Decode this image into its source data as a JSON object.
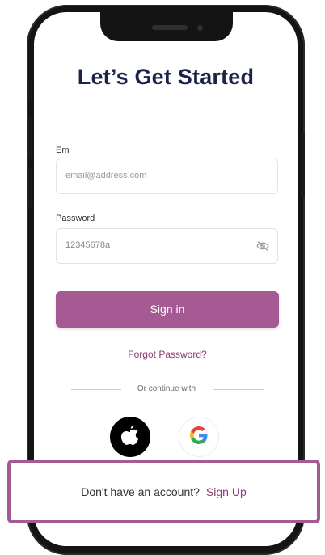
{
  "screen": {
    "title": "Let’s Get Started"
  },
  "email": {
    "label": "Em",
    "placeholder": "email@address.com"
  },
  "password": {
    "label": "Password",
    "value": "12345678a",
    "toggle_icon": "eye-off-icon"
  },
  "actions": {
    "sign_in": "Sign in",
    "forgot_password": "Forgot Password?",
    "divider": "Or continue with",
    "social": [
      {
        "provider": "apple",
        "icon": "apple-icon"
      },
      {
        "provider": "google",
        "icon": "google-icon"
      }
    ]
  },
  "footer": {
    "prompt": "Don't have an account?",
    "link": "Sign Up"
  },
  "colors": {
    "primary": "#a55a93",
    "link": "#8a3c79",
    "title": "#1d2348"
  }
}
